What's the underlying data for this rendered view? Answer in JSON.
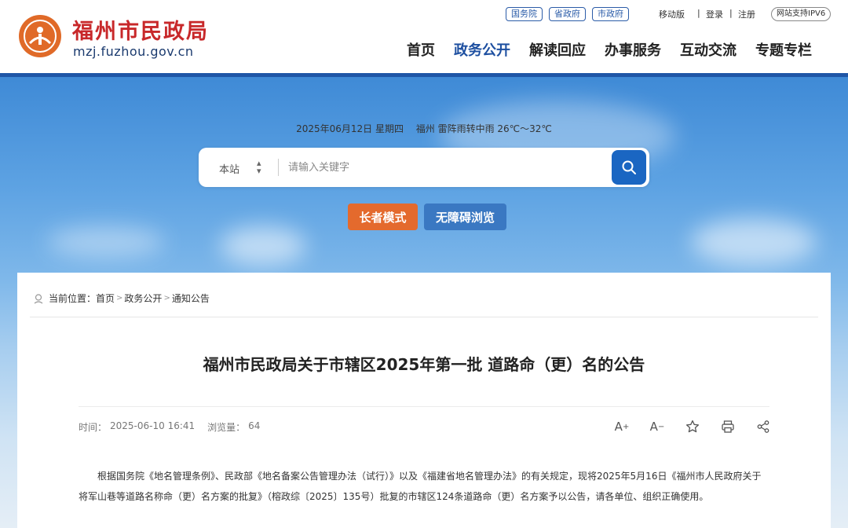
{
  "header": {
    "logo_title": "福州市民政局",
    "logo_url": "mzj.fuzhou.gov.cn",
    "top_pills": [
      "国务院",
      "省政府",
      "市政府"
    ],
    "mobile": "移动版",
    "login": "登录",
    "register": "注册",
    "ipv6": "网站支持IPV6",
    "nav": [
      "首页",
      "政务公开",
      "解读回应",
      "办事服务",
      "互动交流",
      "专题专栏"
    ]
  },
  "banner": {
    "date_weather": "2025年06月12日 星期四　 福州 雷阵雨转中雨 26℃～32℃",
    "search_scope": "本站",
    "search_placeholder": "请输入关键字",
    "elder_mode": "长者模式",
    "accessible": "无障碍浏览"
  },
  "breadcrumb": {
    "prefix": "当前位置：",
    "items": [
      "首页",
      "政务公开",
      "通知公告"
    ]
  },
  "article": {
    "title": "福州市民政局关于市辖区2025年第一批 道路命（更）名的公告",
    "time_label": "时间：",
    "time_value": "2025-06-10 16:41",
    "views_label": "浏览量：",
    "views_value": "64",
    "body": "根据国务院《地名管理条例》、民政部《地名备案公告管理办法（试行）》以及《福建省地名管理办法》的有关规定，现将2025年5月16日《福州市人民政府关于将军山巷等道路名称命（更）名方案的批复》（榕政综〔2025〕135号）批复的市辖区124条道路命（更）名方案予以公告，请各单位、组织正确使用。"
  },
  "colors": {
    "brand_red": "#c8282a",
    "nav_active": "#1d4fa0",
    "header_line": "#1f56a6",
    "elder_orange": "#e46a2d",
    "access_blue": "#3a78c2",
    "search_blue": "#1a66c2"
  }
}
